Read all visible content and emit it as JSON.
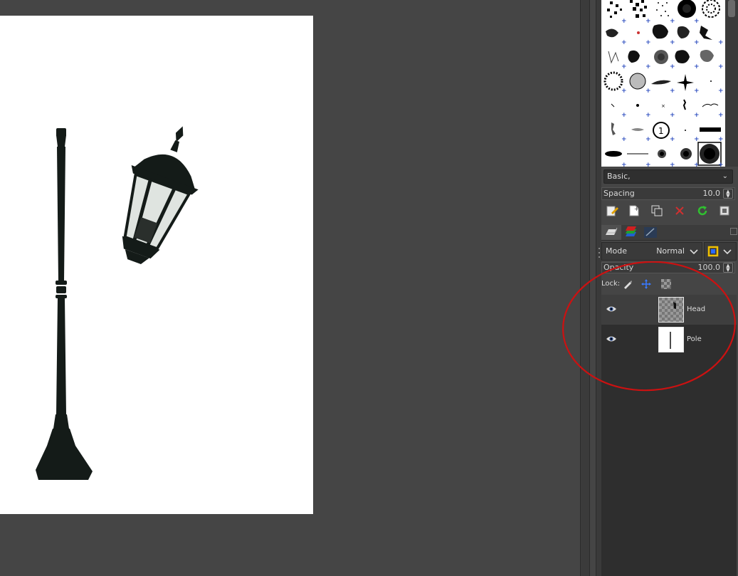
{
  "brushes": {
    "set_label": "Basic,",
    "spacing": {
      "label": "Spacing",
      "value": "10.0"
    }
  },
  "layers": {
    "mode": {
      "label": "Mode",
      "value": "Normal"
    },
    "opacity": {
      "label": "Opacity",
      "value": "100.0"
    },
    "lock_label": "Lock:",
    "items": [
      {
        "name": "Head",
        "visible": true,
        "selected": true
      },
      {
        "name": "Pole",
        "visible": true,
        "selected": false
      }
    ]
  },
  "colors": {
    "annotation": "#cc1111",
    "canvas_bg": "#454545",
    "image_bg": "#ffffff"
  }
}
